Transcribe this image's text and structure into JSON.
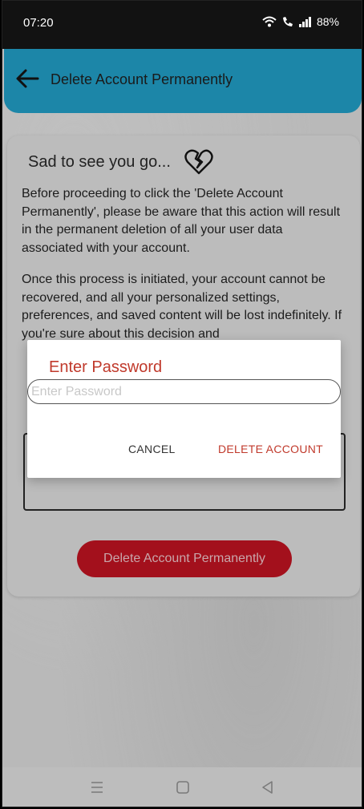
{
  "status_bar": {
    "time": "07:20",
    "battery": "88%"
  },
  "app_bar": {
    "title": "Delete Account Permanently"
  },
  "card": {
    "heading": "Sad to see you go...",
    "paragraph1": "Before proceeding to click the 'Delete Account Permanently', please be aware that this action will result in the permanent deletion of all your user data associated with your account.",
    "paragraph2": "Once this process is initiated, your account cannot be recovered, and all your personalized settings, preferences, and saved content will be lost indefinitely. If you're sure about this decision and",
    "delete_button_label": "Delete Account Permanently"
  },
  "dialog": {
    "title": "Enter Password",
    "password_placeholder": "Enter Password",
    "password_value": "",
    "cancel_label": "CANCEL",
    "confirm_label": "DELETE ACCOUNT"
  },
  "colors": {
    "app_bar": "#1c86a8",
    "danger": "#c0392b",
    "button": "#a3101c"
  },
  "icons": {
    "back": "arrow-left-icon",
    "heart": "broken-heart-icon",
    "wifi": "wifi-icon",
    "call": "wifi-call-icon",
    "signal": "signal-icon",
    "menu": "menu-icon",
    "home": "home-icon",
    "back_nav": "back-triangle-icon"
  }
}
